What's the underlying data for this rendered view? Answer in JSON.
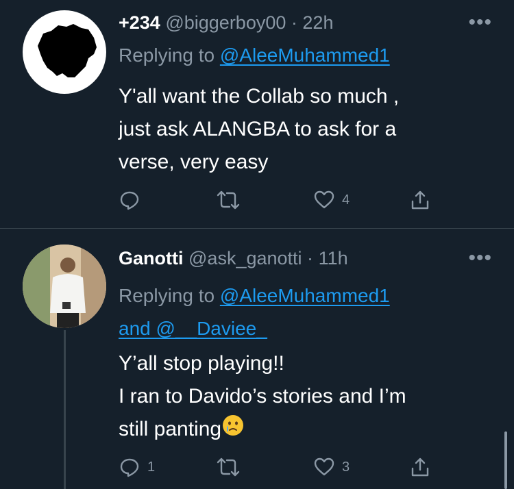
{
  "tweets": [
    {
      "name": "+234",
      "handle": "@biggerboy00",
      "separator": "·",
      "time": "22h",
      "more_label": "•••",
      "replying_prefix": "Replying to ",
      "replying_to": "@AleeMuhammed1",
      "lines": [
        "Y'all want the Collab so much ,",
        "just ask ALANGBA to ask for a",
        "verse, very easy"
      ],
      "reply_count": "",
      "retweet_count": "",
      "like_count": "4"
    },
    {
      "name": "Ganotti",
      "handle": "@ask_ganotti",
      "separator": "·",
      "time": "11h",
      "more_label": "•••",
      "replying_prefix": "Replying to ",
      "replying_to": "@AleeMuhammed1",
      "replying_and": "and ",
      "replying_to_2": "@__Daviee_",
      "lines": [
        "Y’all stop playing!!",
        "I ran to Davido’s stories and I’m",
        "still panting"
      ],
      "reply_count": "1",
      "retweet_count": "",
      "like_count": "3"
    }
  ],
  "colors": {
    "background": "#15202b",
    "text_primary": "#ffffff",
    "text_secondary": "#8b98a5",
    "accent": "#1d9bf0",
    "divider": "#38444d"
  },
  "icons": [
    "reply-icon",
    "retweet-icon",
    "like-icon",
    "share-icon",
    "more-icon",
    "crying-face-emoji"
  ]
}
